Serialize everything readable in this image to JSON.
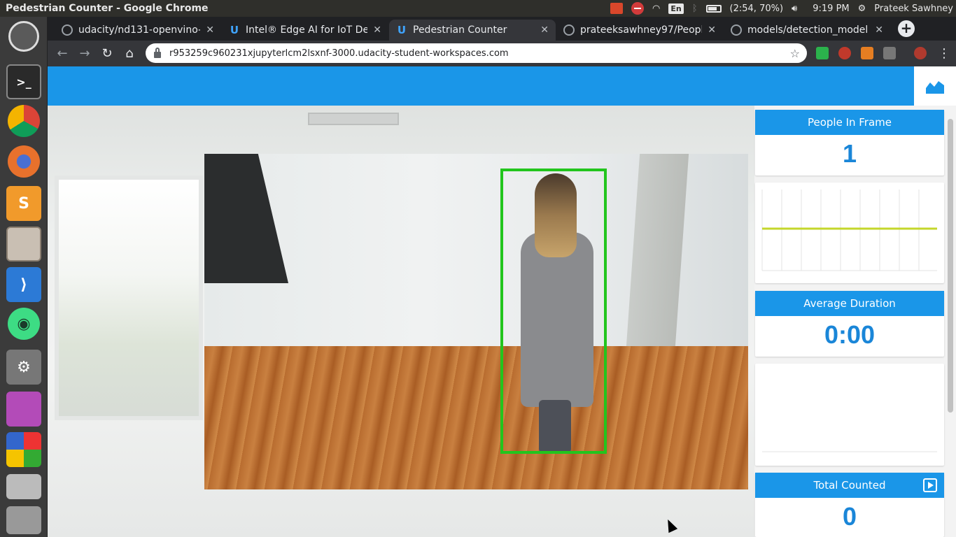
{
  "system": {
    "window_title": "Pedestrian Counter - Google Chrome",
    "battery": "(2:54, 70%)",
    "keyboard": "En",
    "clock": "9:19 PM",
    "user": "Prateek Sawhney"
  },
  "launcher": {
    "apps": [
      "ubuntu-dash-icon",
      "terminal-icon",
      "chrome-icon",
      "firefox-icon",
      "sublime-text-icon",
      "files-icon",
      "vscode-icon",
      "android-studio-icon",
      "system-settings-icon",
      "app-window-icon",
      "software-center-icon",
      "disk-drive-icon",
      "trash-icon"
    ]
  },
  "browser": {
    "tabs": [
      {
        "label": "udacity/nd131-openvino-f",
        "icon": "github-icon"
      },
      {
        "label": "Intel® Edge AI for IoT Dev",
        "icon": "udacity-icon"
      },
      {
        "label": "Pedestrian Counter",
        "icon": "udacity-icon",
        "active": true
      },
      {
        "label": "prateeksawhney97/Peopl",
        "icon": "github-icon"
      },
      {
        "label": "models/detection_model",
        "icon": "github-icon"
      }
    ],
    "url": "r953259c960231xjupyterlcm2lsxnf-3000.udacity-student-workspaces.com"
  },
  "dashboard": {
    "people_in_frame_label": "People In Frame",
    "people_in_frame_value": "1",
    "average_duration_label": "Average Duration",
    "average_duration_value": "0:00",
    "total_counted_label": "Total Counted",
    "total_counted_value": "0",
    "accent_color": "#1a96e8",
    "bbox_color": "#22c51d",
    "graph_line_color": "#c4d62b"
  }
}
